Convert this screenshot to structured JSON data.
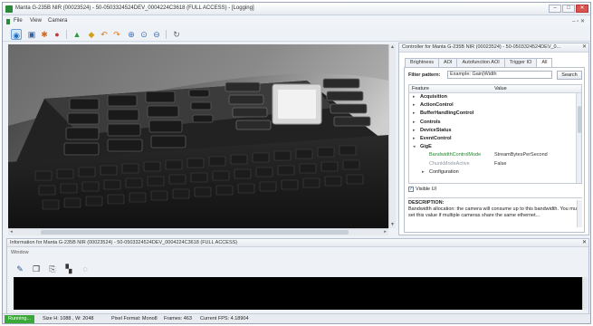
{
  "window": {
    "title": "Manta G-235B NIR (00023524) - 50-0503324524DEV_0004224C3618 (FULL ACCESS) - [Logging]",
    "min_label": "–",
    "max_label": "□",
    "close_label": "✕"
  },
  "menu": {
    "items": [
      "File",
      "View",
      "Camera"
    ],
    "mdi_controls": "– ▫ ✕"
  },
  "toolbar": {
    "icons": [
      "live-view-icon",
      "save-icon",
      "capture-icon",
      "record-icon",
      "trigger-icon",
      "color-icon",
      "rotate-left-icon",
      "rotate-right-icon",
      "zoom-in-icon",
      "zoom-fit-icon",
      "zoom-out-icon",
      "refresh-icon"
    ]
  },
  "controller": {
    "title": "Controller for Manta G-235B NIR (00023524) - 50-0503324524DEV_0...",
    "controls": "✕",
    "tabs": [
      "Brightness",
      "AOI",
      "Autofunction AOI",
      "Trigger IO",
      "All"
    ],
    "selected_tab": 4,
    "filter_label": "Filter pattern:",
    "filter_value": "Example: Gain|Width",
    "search_label": "Search",
    "tree_headers": {
      "feature": "Feature",
      "value": "Value"
    },
    "rows": [
      {
        "arrow": "▸",
        "name": "Acquisition",
        "value": "",
        "style": "bold",
        "indent": 1
      },
      {
        "arrow": "▸",
        "name": "ActionControl",
        "value": "",
        "style": "bold",
        "indent": 1
      },
      {
        "arrow": "▸",
        "name": "BufferHandlingControl",
        "value": "",
        "style": "bold",
        "indent": 1
      },
      {
        "arrow": "▸",
        "name": "Controls",
        "value": "",
        "style": "bold",
        "indent": 1
      },
      {
        "arrow": "▸",
        "name": "DeviceStatus",
        "value": "",
        "style": "bold",
        "indent": 1
      },
      {
        "arrow": "▸",
        "name": "EventControl",
        "value": "",
        "style": "bold",
        "indent": 1
      },
      {
        "arrow": "◂",
        "name": "GigE",
        "value": "",
        "style": "bold",
        "indent": 1
      },
      {
        "arrow": "",
        "name": "BandwidthControlMode",
        "value": "StreamBytesPerSecond",
        "style": "green",
        "indent": 2
      },
      {
        "arrow": "",
        "name": "ChunkModeActive",
        "value": "False",
        "style": "grey",
        "indent": 2
      },
      {
        "arrow": "▸",
        "name": "Configuration",
        "value": "",
        "style": "normal",
        "indent": 2
      }
    ],
    "visible_ui_label": "Visible UI",
    "description_title": "DESCRIPTION:",
    "description_text": "Bandwidth allocation: the camera will consume up to this bandwidth. You must set this value if multiple cameras share the same ethernet..."
  },
  "info": {
    "title": "Information for Manta G-235B NIR (00023524) - 50-0503324524DEV_0004224C3618 (FULL ACCESS)",
    "window_label": "Window",
    "controls": "✕",
    "icons": [
      "pen-icon",
      "copy-icon",
      "save-log-icon",
      "clear-icon",
      "settings-icon"
    ]
  },
  "status": {
    "running": "Running...",
    "size": "Size H: 1088 , W: 2048",
    "pixel_format": "Pixel Format: Mono8",
    "frames": "Frames: 463",
    "fps": "Current FPS: 4.18904"
  }
}
